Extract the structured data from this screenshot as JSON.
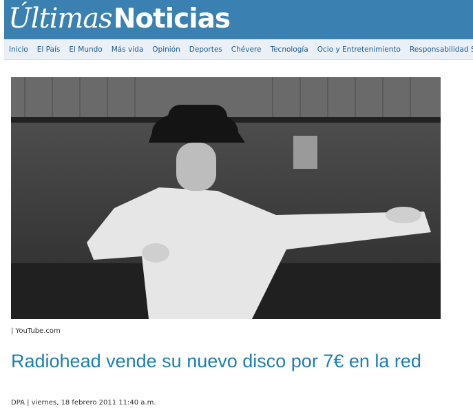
{
  "brand": {
    "part1": "Últimas",
    "part2": "Noticias"
  },
  "nav": [
    "Inicio",
    "El País",
    "El Mundo",
    "Más vida",
    "Opinión",
    "Deportes",
    "Chévere",
    "Tecnología",
    "Ocio y Entretenimiento",
    "Responsabilidad Social"
  ],
  "photo": {
    "credit": "| YouTube.com"
  },
  "article": {
    "headline": "Radiohead vende su nuevo disco por 7€ en la red",
    "byline": "DPA | viernes, 18 febrero 2011 11:40 a.m."
  },
  "colors": {
    "masthead": "#3a80b0",
    "nav_bg": "#eaf0f6",
    "headline": "#1b7fb6"
  }
}
